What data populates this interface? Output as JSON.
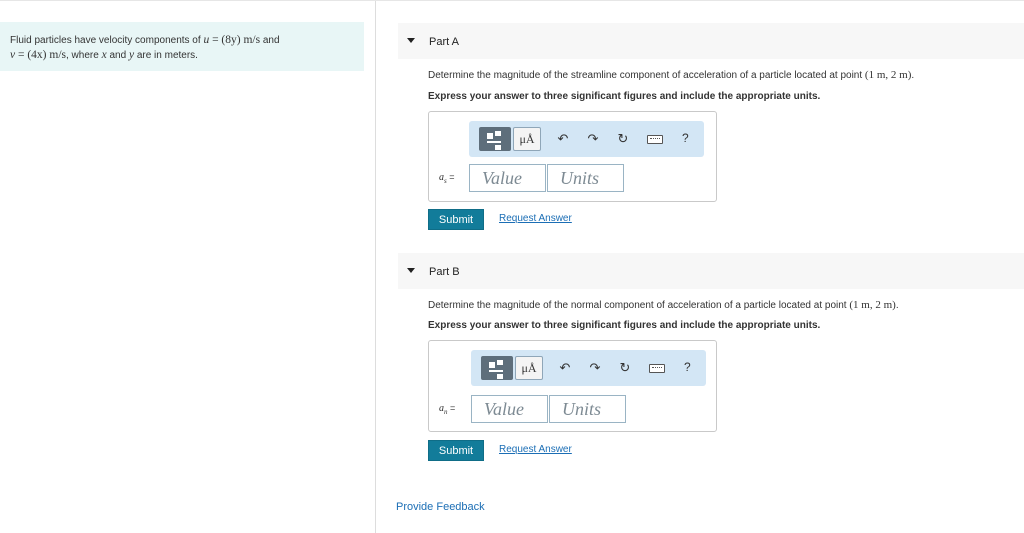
{
  "problem": {
    "text_before_u": "Fluid particles have velocity components of ",
    "u_var": "u",
    "u_expr": " = (8y) m/s",
    "text_and": " and",
    "v_var": "v",
    "v_expr": " = (4x) m/s",
    "text_where": ", where ",
    "x_var": "x",
    "text_and2": " and ",
    "y_var": "y",
    "text_end": " are in meters."
  },
  "partA": {
    "title": "Part A",
    "prompt": "Determine the magnitude of the streamline component of acceleration of a particle located at point ",
    "point": "(1 m, 2 m)",
    "period": ".",
    "instructions": "Express your answer to three significant figures and include the appropriate units.",
    "var_label": "a",
    "var_sub": "s",
    "var_eq": " =",
    "value_placeholder": "Value",
    "units_placeholder": "Units",
    "submit": "Submit",
    "request": "Request Answer"
  },
  "partB": {
    "title": "Part B",
    "prompt": "Determine the magnitude of the normal component of acceleration of a particle located at point ",
    "point": "(1 m, 2 m)",
    "period": ".",
    "instructions": "Express your answer to three significant figures and include the appropriate units.",
    "var_label": "a",
    "var_sub": "n",
    "var_eq": " =",
    "value_placeholder": "Value",
    "units_placeholder": "Units",
    "submit": "Submit",
    "request": "Request Answer"
  },
  "toolbar": {
    "units_glyph": "μÅ",
    "undo_glyph": "↶",
    "redo_glyph": "↷",
    "reset_glyph": "↻",
    "help_glyph": "?"
  },
  "feedback": "Provide Feedback"
}
